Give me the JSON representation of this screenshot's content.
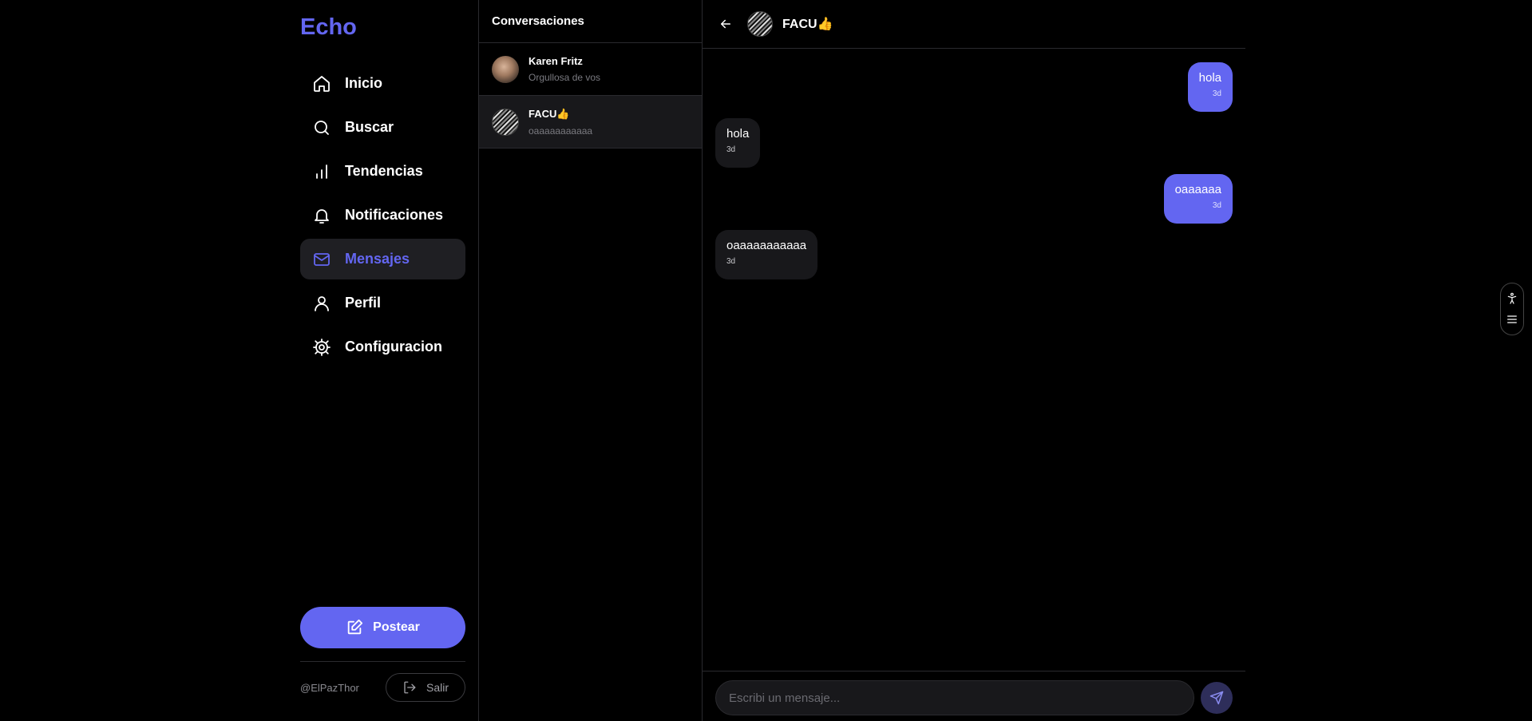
{
  "app": {
    "logo": "Echo",
    "accent_color": "#6366f1"
  },
  "sidebar": {
    "items": [
      {
        "label": "Inicio",
        "icon": "home-icon"
      },
      {
        "label": "Buscar",
        "icon": "search-icon"
      },
      {
        "label": "Tendencias",
        "icon": "bar-chart-icon"
      },
      {
        "label": "Notificaciones",
        "icon": "bell-icon"
      },
      {
        "label": "Mensajes",
        "icon": "mail-icon",
        "active": true
      },
      {
        "label": "Perfil",
        "icon": "user-icon"
      },
      {
        "label": "Configuracion",
        "icon": "gear-icon"
      }
    ],
    "post_label": "Postear",
    "handle": "@ElPazThor",
    "logout_label": "Salir"
  },
  "conversations": {
    "title": "Conversaciones",
    "items": [
      {
        "name": "Karen Fritz",
        "preview": "Orgullosa de vos"
      },
      {
        "name": "FACU👍",
        "preview": "oaaaaaaaaaaa",
        "active": true
      }
    ]
  },
  "chat": {
    "name": "FACU👍",
    "messages": [
      {
        "text": "hola",
        "time": "3d",
        "direction": "out"
      },
      {
        "text": "hola",
        "time": "3d",
        "direction": "in"
      },
      {
        "text": "oaaaaaa",
        "time": "3d",
        "direction": "out"
      },
      {
        "text": "oaaaaaaaaaaa",
        "time": "3d",
        "direction": "in"
      }
    ],
    "composer_placeholder": "Escribi un mensaje..."
  }
}
